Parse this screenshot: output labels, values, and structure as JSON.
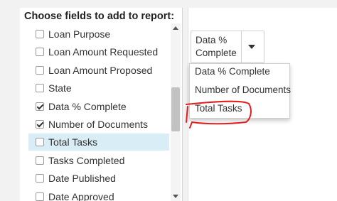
{
  "panel": {
    "title": "Choose fields to add to report:",
    "fields": [
      {
        "label": "Loan Purpose",
        "checked": false,
        "selected": false
      },
      {
        "label": "Loan Amount Requested",
        "checked": false,
        "selected": false
      },
      {
        "label": "Loan Amount Proposed",
        "checked": false,
        "selected": false
      },
      {
        "label": "State",
        "checked": false,
        "selected": false
      },
      {
        "label": "Data % Complete",
        "checked": true,
        "selected": false
      },
      {
        "label": "Number of Documents",
        "checked": true,
        "selected": false
      },
      {
        "label": "Total Tasks",
        "checked": false,
        "selected": true
      },
      {
        "label": "Tasks Completed",
        "checked": false,
        "selected": false
      },
      {
        "label": "Date Published",
        "checked": false,
        "selected": false
      },
      {
        "label": "Date Approved",
        "checked": false,
        "selected": false
      }
    ]
  },
  "select": {
    "value": "Data % Complete",
    "options": [
      "Data % Complete",
      "Number of Documents",
      "Total Tasks"
    ]
  },
  "annotation": {
    "color": "#e02020",
    "target": "Total Tasks"
  }
}
